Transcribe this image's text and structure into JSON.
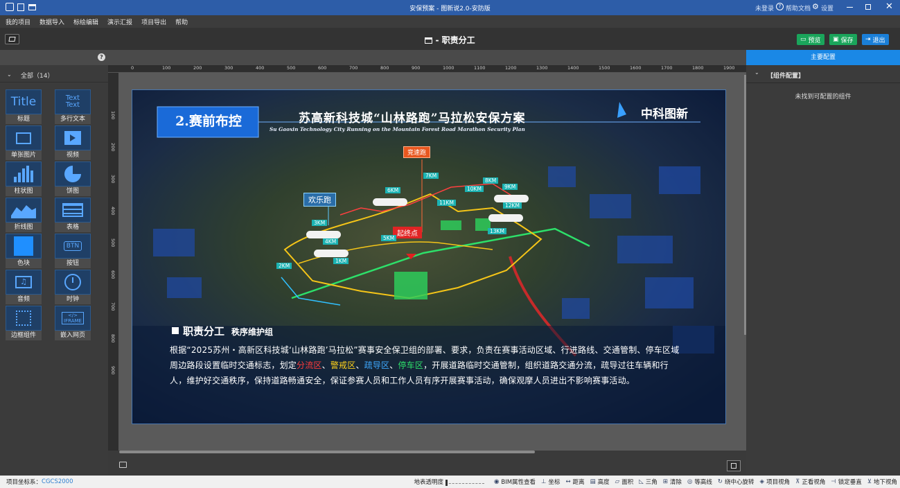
{
  "window": {
    "title": "安保预案 - 图新说2.0-安防版",
    "login": "未登录",
    "help": "帮助文档",
    "settings": "设置"
  },
  "menu": [
    "我的项目",
    "数据导入",
    "标绘编辑",
    "演示汇报",
    "项目导出",
    "帮助"
  ],
  "toolbar": {
    "page_title": "职责分工",
    "preview": "预览",
    "save": "保存",
    "exit": "退出"
  },
  "left": {
    "group_label": "全部（14）",
    "components": [
      {
        "icon": "Title",
        "label": "标题"
      },
      {
        "icon": "Text Text",
        "label": "多行文本"
      },
      {
        "icon": "image-icon",
        "label": "单张图片"
      },
      {
        "icon": "video-icon",
        "label": "视频"
      },
      {
        "icon": "bar-chart-icon",
        "label": "柱状图"
      },
      {
        "icon": "pie-chart-icon",
        "label": "饼图"
      },
      {
        "icon": "line-chart-icon",
        "label": "折线图"
      },
      {
        "icon": "table-icon",
        "label": "表格"
      },
      {
        "icon": "color-block-icon",
        "label": "色块"
      },
      {
        "icon": "BTN",
        "label": "按钮"
      },
      {
        "icon": "audio-icon",
        "label": "音频"
      },
      {
        "icon": "clock-icon",
        "label": "时钟"
      },
      {
        "icon": "border-icon",
        "label": "边框组件"
      },
      {
        "icon": "IFRAME",
        "label": "嵌入网页"
      }
    ]
  },
  "ruler": [
    "0",
    "100",
    "200",
    "300",
    "400",
    "500",
    "600",
    "700",
    "800",
    "900",
    "1000",
    "1100",
    "1200",
    "1300",
    "1400",
    "1500",
    "1600",
    "1700",
    "1800",
    "1900"
  ],
  "vruler": [
    "100",
    "200",
    "300",
    "400",
    "500",
    "600",
    "700",
    "800",
    "900"
  ],
  "slide": {
    "badge": "2.赛前布控",
    "header_cn": "苏高新科技城“山林路跑”马拉松安保方案",
    "header_en": "Su Gaoxin Technology City Running on the Mountain Forest Road Marathon Security Plan",
    "logo": "中科图新",
    "map_labels": {
      "race": "竞速跑",
      "fun": "欢乐跑",
      "start": "起终点",
      "km": [
        "7KM",
        "6KM",
        "10KM",
        "8KM",
        "9KM",
        "11KM",
        "12KM",
        "3KM",
        "5KM",
        "13KM",
        "4KM",
        "2KM",
        "1KM"
      ]
    },
    "section_title": "职责分工",
    "section_sub": "秩序维护组",
    "body_1": "根据“2025苏州・高新区科技城‘山林路跑’马拉松”赛事安全保卫组的部署、要求，负责在赛事活动区域、行进路线、交通管制、停车区域周边路段设置临时交通标志，划定",
    "zone_1": "分流区",
    "sep_1": "、",
    "zone_2": "警戒区",
    "sep_2": "、",
    "zone_3": "疏导区",
    "sep_3": "、",
    "zone_4": "停车区",
    "body_2": "，开展道路临时交通管制，组织道路交通分流，疏导过往车辆和行人，维护好交通秩序，保持道路畅通安全，保证参赛人员和工作人员有序开展赛事活动，确保观摩人员进出不影响赛事活动。"
  },
  "right": {
    "tab": "主要配置",
    "section": "【组件配置】",
    "empty": "未找到可配置的组件"
  },
  "status": {
    "coord_label": "项目坐标系：",
    "coord_value": "CGCS2000",
    "items": [
      "地表透明度",
      "BIM属性查看",
      "坐标",
      "距离",
      "高度",
      "面积",
      "三角",
      "清除",
      "等高线",
      "绕中心旋转",
      "项目视角",
      "正看视角",
      "锁定垂直",
      "地下视角"
    ]
  },
  "colors": {
    "accent": "#2d5da8",
    "zone_1": "#ff3b3b",
    "zone_2": "#ffd21a",
    "zone_3": "#3fa9ff",
    "zone_4": "#2ee06a"
  }
}
